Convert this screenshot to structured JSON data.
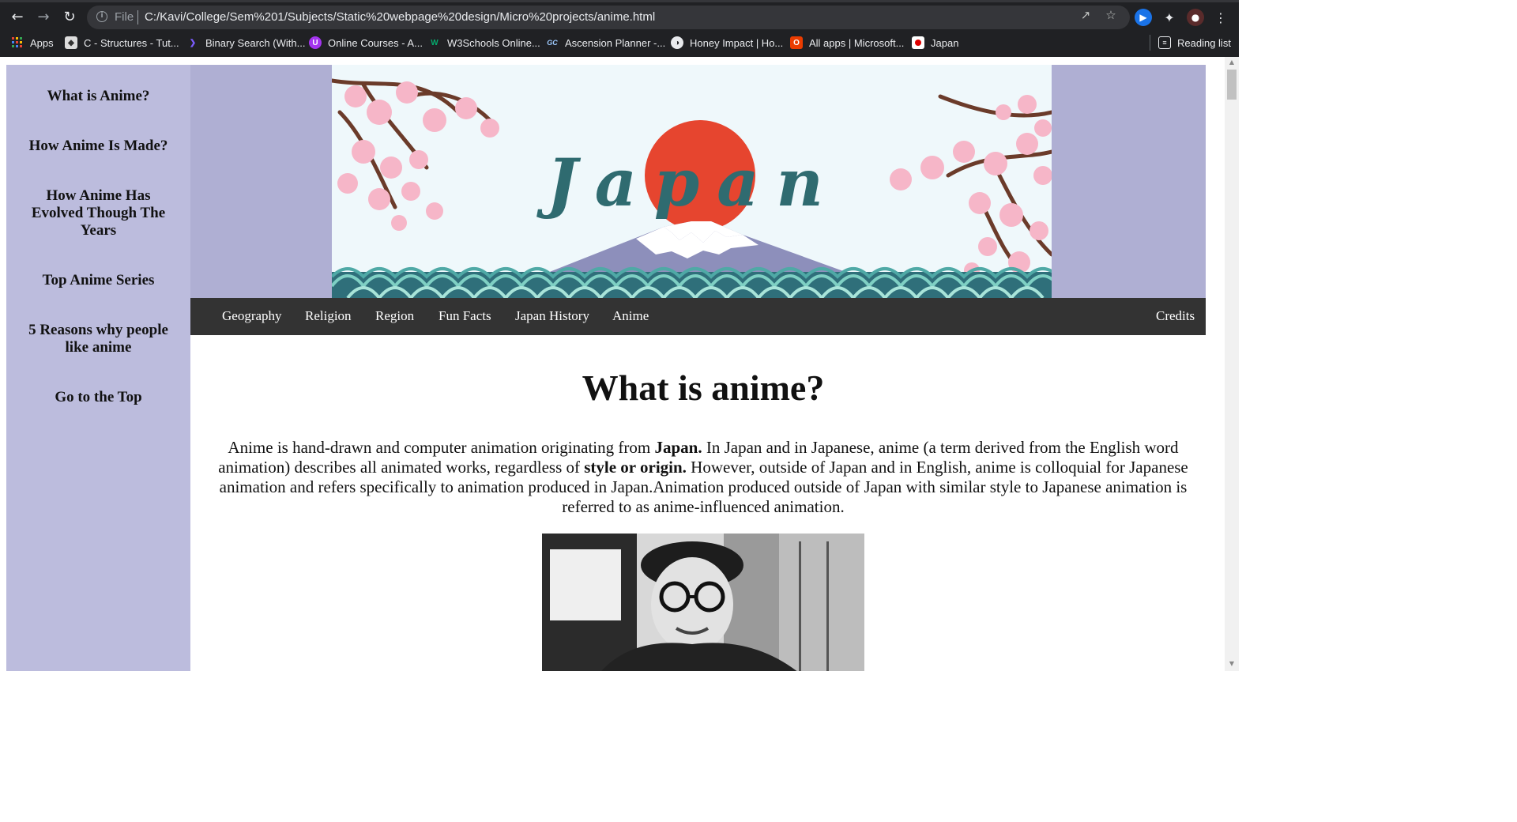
{
  "browser": {
    "url_scheme": "File",
    "url": "C:/Kavi/College/Sem%201/Subjects/Static%20webpage%20design/Micro%20projects/anime.html",
    "bookmarks": [
      {
        "label": "Apps",
        "icon": "apps-grid-icon"
      },
      {
        "label": "C - Structures - Tut...",
        "icon": "tutorial-site-icon"
      },
      {
        "label": "Binary Search (With...",
        "icon": "programiz-icon"
      },
      {
        "label": "Online Courses - A...",
        "icon": "udemy-icon"
      },
      {
        "label": "W3Schools Online...",
        "icon": "w3schools-icon"
      },
      {
        "label": "Ascension Planner -...",
        "icon": "gc-icon"
      },
      {
        "label": "Honey Impact | Ho...",
        "icon": "honey-impact-icon"
      },
      {
        "label": "All apps | Microsoft...",
        "icon": "office-icon"
      },
      {
        "label": "Japan",
        "icon": "japan-flag-icon"
      }
    ],
    "reading_list": "Reading list"
  },
  "sidebar": {
    "items": [
      {
        "label": "What is Anime?"
      },
      {
        "label": "How Anime Is Made?"
      },
      {
        "label": "How Anime Has Evolved Though The Years"
      },
      {
        "label": "Top Anime Series"
      },
      {
        "label": "5 Reasons why people like anime"
      },
      {
        "label": "Go to the Top"
      }
    ]
  },
  "banner": {
    "title": "Japan"
  },
  "navbar": {
    "items": [
      {
        "label": "Geography"
      },
      {
        "label": "Religion"
      },
      {
        "label": "Region"
      },
      {
        "label": "Fun Facts"
      },
      {
        "label": "Japan History"
      },
      {
        "label": "Anime"
      }
    ],
    "credits": "Credits"
  },
  "content": {
    "title": "What is anime?",
    "p1": "Anime is hand-drawn and computer animation originating from ",
    "b1": "Japan.",
    "p2": " In Japan and in Japanese, anime (a term derived from the English word animation) describes all animated works, regardless of ",
    "b2": "style or origin.",
    "p3": " However, outside of Japan and in English, anime is colloquial for Japanese animation and refers specifically to animation produced in Japan.Animation produced outside of Japan with similar style to Japanese animation is referred to as anime-influenced animation."
  },
  "colors": {
    "sidebar_bg": "#bcbcdd",
    "banner_bg": "#afafd3",
    "navbar_bg": "#333333",
    "sun": "#e6452f",
    "mountain": "#8d8fbb",
    "title_ink": "#2f6b70"
  }
}
